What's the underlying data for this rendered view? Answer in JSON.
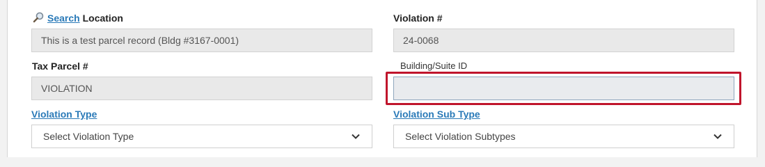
{
  "location": {
    "search_link": "Search",
    "label": "Location",
    "value": "This is a test parcel record (Bldg #3167-0001)"
  },
  "violation_number": {
    "label": "Violation #",
    "value": "24-0068"
  },
  "tax_parcel": {
    "label": "Tax Parcel #",
    "value": "VIOLATION"
  },
  "building_suite": {
    "label": "Building/Suite ID",
    "value": ""
  },
  "violation_type": {
    "label": "Violation Type",
    "selected": "Select Violation Type"
  },
  "violation_sub_type": {
    "label": "Violation Sub Type",
    "selected": "Select Violation Subtypes"
  },
  "colors": {
    "link": "#2a7ab8",
    "highlight": "#c0152c",
    "readonly_bg": "#e9e9e9"
  },
  "icons": {
    "search": "magnifier-icon",
    "select_arrow": "chevron-down-icon"
  }
}
